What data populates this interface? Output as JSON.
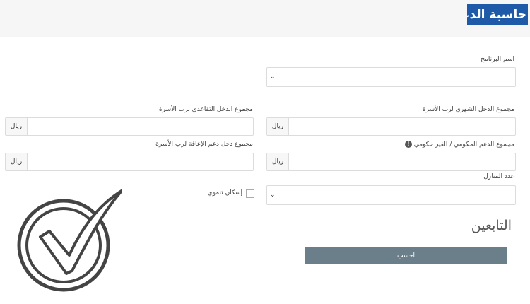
{
  "page": {
    "title": "حاسبة الدعم"
  },
  "form": {
    "program_name": {
      "label": "اسم البرنامج",
      "value": ""
    },
    "monthly_income": {
      "label": "مجموع الدخل الشهري لرب الأسرة",
      "currency": "ريال",
      "value": ""
    },
    "retirement_income": {
      "label": "مجموع الدخل التقاعدي لرب الأسرة",
      "currency": "ريال",
      "value": ""
    },
    "gov_support": {
      "label": "مجموع الدعم الحكومي / الغير حكومي",
      "currency": "ريال",
      "value": "",
      "info_icon": "info-icon"
    },
    "disability_income": {
      "label": "مجموع دخل دعم الإعاقة لرب الأسرة",
      "currency": "ريال",
      "value": ""
    },
    "houses_count": {
      "label": "عدد المنازل",
      "value": ""
    },
    "housing_checkbox": {
      "label": "إسكان تنموي",
      "checked": false
    }
  },
  "dependents": {
    "heading": "التابعين"
  },
  "actions": {
    "calculate_label": "احسب"
  },
  "watermark": {
    "icon": "checkmark-circle-icon"
  }
}
